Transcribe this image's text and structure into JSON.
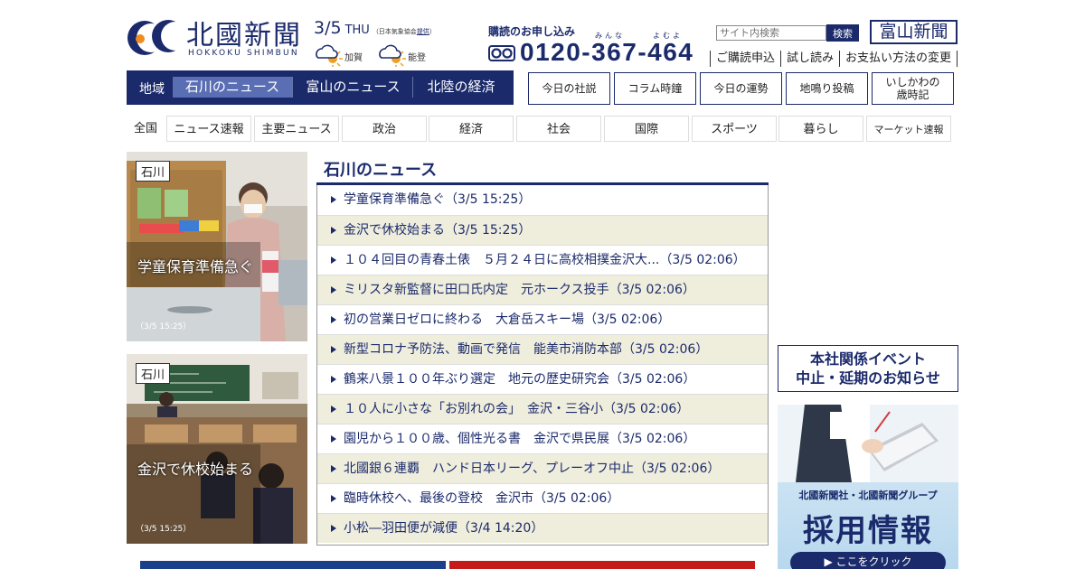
{
  "header": {
    "logo_title": "北國新聞",
    "logo_sub": "HOKKOKU SHIMBUN",
    "date": "3/5",
    "weekday": "THU",
    "weather_source": "（日本気象協会",
    "weather_source_link": "提供",
    "weather_source_end": "）",
    "weather": [
      {
        "region": "加賀",
        "icon": "cloudy-sunny-icon"
      },
      {
        "region": "能登",
        "icon": "cloudy-sunny-icon"
      }
    ],
    "subscribe_title": "購読のお申し込み",
    "ruby_1": "みんな",
    "ruby_2": "よむよ",
    "phone": "0120-367-464",
    "search_placeholder": "サイト内検索",
    "search_button": "検索",
    "toyama_logo": "富山新聞",
    "links": [
      "ご購読申込",
      "試し読み",
      "お支払い方法の変更"
    ]
  },
  "region_nav": {
    "label": "地域",
    "tabs": [
      "石川のニュース",
      "富山のニュース",
      "北陸の経済"
    ],
    "active_index": 0
  },
  "side_buttons": [
    "今日の社説",
    "コラム時鐘",
    "今日の運勢",
    "地鳴り投稿",
    "いしかわの",
    "歳時記"
  ],
  "categories": [
    "全国",
    "ニュース速報",
    "主要ニュース",
    "政治",
    "経済",
    "社会",
    "国際",
    "スポーツ",
    "暮らし",
    "マーケット速報"
  ],
  "photos": [
    {
      "tag": "石川",
      "title": "学童保育準備急ぐ",
      "time": "（3/5 15:25）"
    },
    {
      "tag": "石川",
      "title": "金沢で休校始まる",
      "time": "（3/5 15:25）"
    }
  ],
  "news": {
    "heading": "石川のニュース",
    "items": [
      "学童保育準備急ぐ（3/5 15:25）",
      "金沢で休校始まる（3/5 15:25）",
      "１０４回目の青春土俵　５月２４日に高校相撲金沢大...（3/5 02:06）",
      "ミリスタ新監督に田口氏内定　元ホークス投手（3/5 02:06）",
      "初の営業日ゼロに終わる　大倉岳スキー場（3/5 02:06）",
      "新型コロナ予防法、動画で発信　能美市消防本部（3/5 02:06）",
      "鶴来八景１００年ぶり選定　地元の歴史研究会（3/5 02:06）",
      "１０人に小さな「お別れの会」　金沢・三谷小（3/5 02:06）",
      "園児から１００歳、個性光る書　金沢で県民展（3/5 02:06）",
      "北國銀６連覇　ハンド日本リーグ、プレーオフ中止（3/5 02:06）",
      "臨時休校へ、最後の登校　金沢市（3/5 02:06）",
      "小松―羽田便が減便（3/4 14:20）"
    ]
  },
  "notice": {
    "line1": "本社関係イベント",
    "line2": "中止・延期のお知らせ"
  },
  "recruit": {
    "line1": "北國新聞社・北國新聞グループ",
    "line2": "採用情報",
    "button": "▶ ここをクリック"
  },
  "colors": {
    "brand_navy": "#1b2a6b",
    "active_tab": "#5a6eb4",
    "row_alt": "#efeedd"
  }
}
